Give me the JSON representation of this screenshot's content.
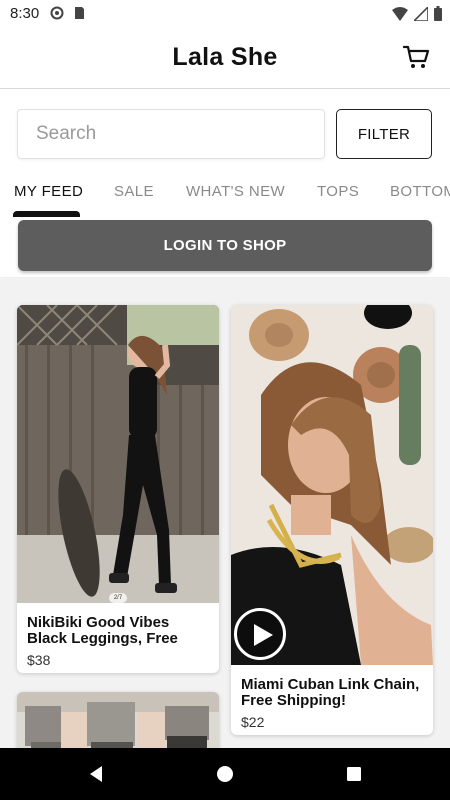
{
  "status_bar": {
    "time": "8:30",
    "left_icons": [
      "sync-icon",
      "sd-card-icon"
    ],
    "right_icons": [
      "wifi-icon",
      "signal-icon",
      "battery-icon"
    ]
  },
  "header": {
    "title": "Lala She",
    "cart_icon": "cart-icon"
  },
  "search": {
    "placeholder": "Search",
    "value": "",
    "filter_label": "FILTER"
  },
  "tabs": [
    {
      "label": "MY FEED",
      "active": true
    },
    {
      "label": "SALE",
      "active": false
    },
    {
      "label": "WHAT'S NEW",
      "active": false
    },
    {
      "label": "TOPS",
      "active": false
    },
    {
      "label": "BOTTOMS",
      "active": false
    }
  ],
  "login": {
    "label": "LOGIN TO SHOP"
  },
  "products": [
    {
      "title": "NikiBiki Good Vibes Black Leggings, Free",
      "price": "$38",
      "image_counter": "2/7"
    },
    {
      "title": "Miami Cuban Link Chain, Free Shipping!",
      "price": "$22",
      "has_video": true
    }
  ],
  "nav": {
    "back_icon": "back-triangle-icon",
    "home_icon": "home-circle-icon",
    "recents_icon": "recents-square-icon"
  },
  "colors": {
    "login_button": "#5d5d5d",
    "feed_background": "#f2f2f2",
    "active_tab": "#111111",
    "inactive_tab": "#8a8a8a"
  }
}
